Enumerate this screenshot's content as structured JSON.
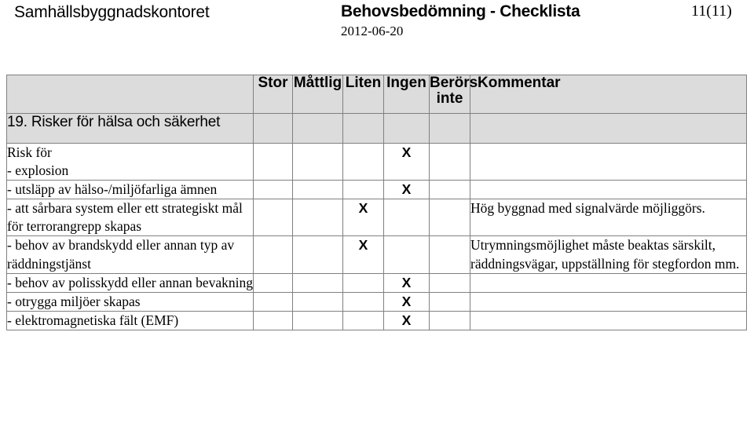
{
  "header": {
    "organization": "Samhällsbyggnadskontoret",
    "title": "Behovsbedömning - Checklista",
    "date": "2012-06-20",
    "page_number": "11(11)"
  },
  "table": {
    "columns": [
      {
        "key": "label",
        "label": ""
      },
      {
        "key": "stor",
        "label": "Stor"
      },
      {
        "key": "mattlig",
        "label": "Måttlig"
      },
      {
        "key": "liten",
        "label": "Liten"
      },
      {
        "key": "ingen",
        "label": "Ingen"
      },
      {
        "key": "berors",
        "label_line1": "Berörs",
        "label_line2": "inte"
      },
      {
        "key": "kommentar",
        "label": "Kommentar"
      }
    ],
    "section": {
      "number": "19.",
      "title": "19. Risker för hälsa och säkerhet"
    },
    "mark": "X",
    "rows": [
      {
        "lead": "Risk för",
        "label": "- explosion",
        "mark_column": "ingen",
        "comment": ""
      },
      {
        "lead": "",
        "label": "- utsläpp av hälso-/miljöfarliga ämnen",
        "mark_column": "ingen",
        "comment": ""
      },
      {
        "lead": "",
        "label": "- att sårbara system eller ett strategiskt mål för terrorangrepp skapas",
        "mark_column": "liten",
        "comment": "Hög byggnad med signalvärde möjliggörs."
      },
      {
        "lead": "",
        "label": "- behov av brandskydd eller annan typ av räddningstjänst",
        "mark_column": "liten",
        "comment": "Utrymningsmöjlighet måste beaktas särskilt, räddningsvägar, uppställning för stegfordon mm."
      },
      {
        "lead": "",
        "label": "- behov av polisskydd eller annan bevakning",
        "mark_column": "ingen",
        "comment": ""
      },
      {
        "lead": "",
        "label": "- otrygga miljöer skapas",
        "mark_column": "ingen",
        "comment": ""
      },
      {
        "lead": "",
        "label": "- elektromagnetiska fält (EMF)",
        "mark_column": "ingen",
        "comment": ""
      }
    ]
  },
  "colors": {
    "header_fill": "#dcdcdc",
    "border": "#808080",
    "text": "#000000",
    "page_background": "#ffffff"
  }
}
